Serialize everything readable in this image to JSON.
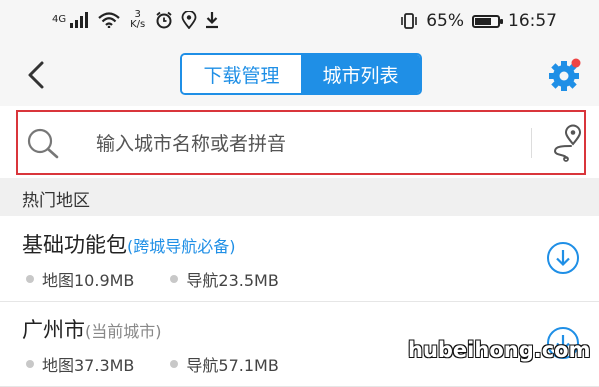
{
  "status_bar": {
    "network": "4G",
    "speed_value": "3",
    "speed_unit": "K/s",
    "battery": "65%",
    "battery_level": 0.65,
    "time": "16:57"
  },
  "nav": {
    "tabs": [
      {
        "label": "下载管理",
        "active": false
      },
      {
        "label": "城市列表",
        "active": true
      }
    ],
    "accent": "#1f8fe6",
    "notification_color": "#ee4444"
  },
  "search": {
    "placeholder": "输入城市名称或者拼音",
    "highlight_color": "#d9353b"
  },
  "section": {
    "title": "热门地区"
  },
  "items": [
    {
      "name": "基础功能包",
      "note": "(跨城导航必备)",
      "map_size": "地图10.9MB",
      "nav_size": "导航23.5MB"
    },
    {
      "name": "广州市",
      "note": "(当前城市)",
      "map_size": "地图37.3MB",
      "nav_size": "导航57.1MB"
    }
  ],
  "watermark": "hubeihong.com"
}
